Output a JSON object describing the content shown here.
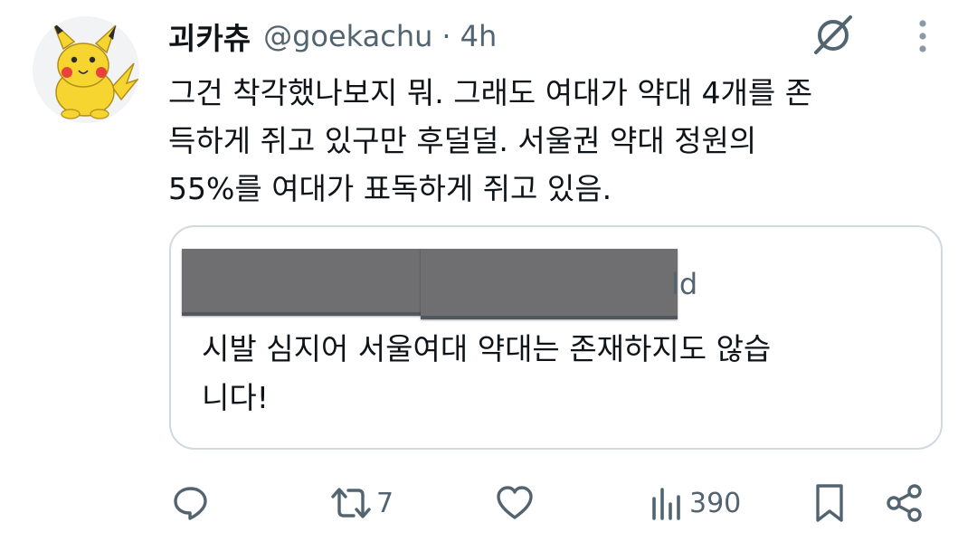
{
  "tweet": {
    "display_name": "괴카츄",
    "handle": "@goekachu",
    "separator": "·",
    "time": "4h",
    "avatar_icon": "pikachu-avatar-icon",
    "text": "그건 착각했나보지 뭐. 그래도 여대가 약대 4개를 존\n득하게 쥐고 있구만 후덜덜. 서울권 약대 정원의\n55%를 여대가 표독하게 쥐고 있음."
  },
  "quote": {
    "handle_tail": "ld",
    "text": "시발 심지어 서울여대 약대는 존재하지도 않습\n니다!"
  },
  "actions": {
    "reply_icon": "reply-icon",
    "retweet_icon": "retweet-icon",
    "retweet_count": "7",
    "like_icon": "heart-icon",
    "views_icon": "views-icon",
    "views_count": "390",
    "bookmark_icon": "bookmark-icon",
    "share_icon": "share-icon"
  },
  "colors": {
    "text": "#0f1419",
    "secondary": "#536471",
    "border": "#cfd9de",
    "pikachu_yellow": "#f6d530",
    "cheek_red": "#e8433a"
  }
}
